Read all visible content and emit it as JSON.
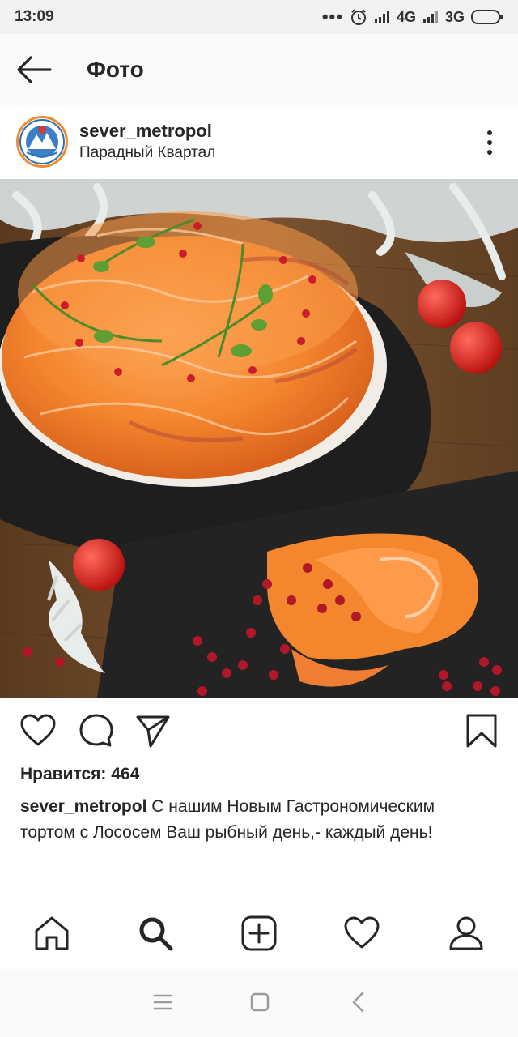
{
  "status_bar": {
    "time": "13:09",
    "dots": "•••",
    "network_1": "4G",
    "network_2": "3G"
  },
  "header": {
    "title": "Фото",
    "back_icon": "arrow-left-icon"
  },
  "post": {
    "username": "sever_metropol",
    "location": "Парадный Квартал",
    "likes_text": "Нравится: 464",
    "caption_user": "sever_metropol",
    "caption_text": " С нашим Новым Гастрономическим тортом с Лососем Ваш рыбный день,- каждый день!"
  },
  "actions": {
    "like_icon": "heart-icon",
    "comment_icon": "comment-icon",
    "share_icon": "send-icon",
    "save_icon": "bookmark-icon"
  },
  "bottom_nav": [
    "home-icon",
    "search-icon",
    "add-post-icon",
    "activity-heart-icon",
    "profile-icon"
  ],
  "colors": {
    "text": "#262626",
    "border": "#dbdbdb",
    "salmon": "#f2842e",
    "slate": "#1e1e1e",
    "wood": "#6b4524"
  }
}
